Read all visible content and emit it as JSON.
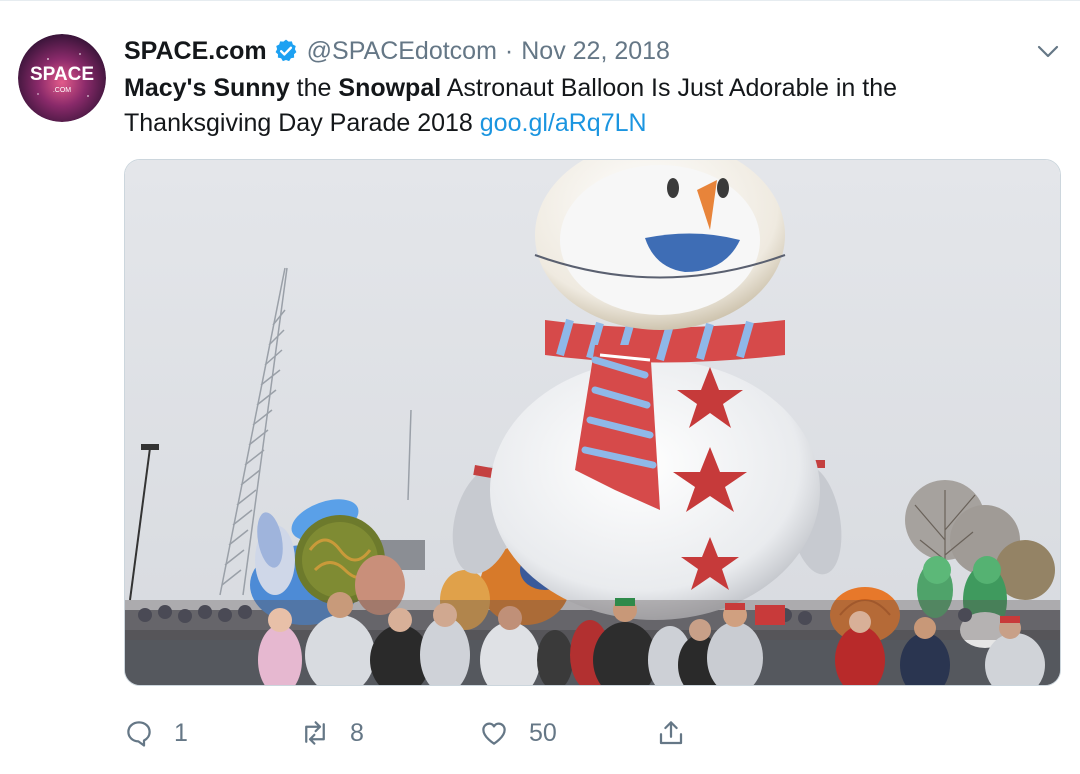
{
  "tweet": {
    "display_name": "SPACE.com",
    "handle": "@SPACEdotcom",
    "separator": "·",
    "date": "Nov 22, 2018",
    "text": {
      "part1": "Macy's Sunny",
      "part2": " the ",
      "part3": "Snowpal",
      "part4": " Astronaut Balloon Is Just Adorable in the Thanksgiving Day Parade 2018 ",
      "link": "goo.gl/aRq7LN"
    },
    "avatar_text": {
      "main": "SPACE",
      "sub": ".COM"
    },
    "actions": {
      "reply_count": "1",
      "retweet_count": "8",
      "like_count": "50"
    }
  },
  "icons": {
    "verified": "verified-badge-icon",
    "caret": "chevron-down-icon",
    "reply": "reply-icon",
    "retweet": "retweet-icon",
    "like": "heart-icon",
    "share": "share-icon"
  },
  "colors": {
    "link": "#1b95e0",
    "verified": "#1da1f2",
    "secondary_text": "#657786",
    "primary_text": "#14171a"
  }
}
